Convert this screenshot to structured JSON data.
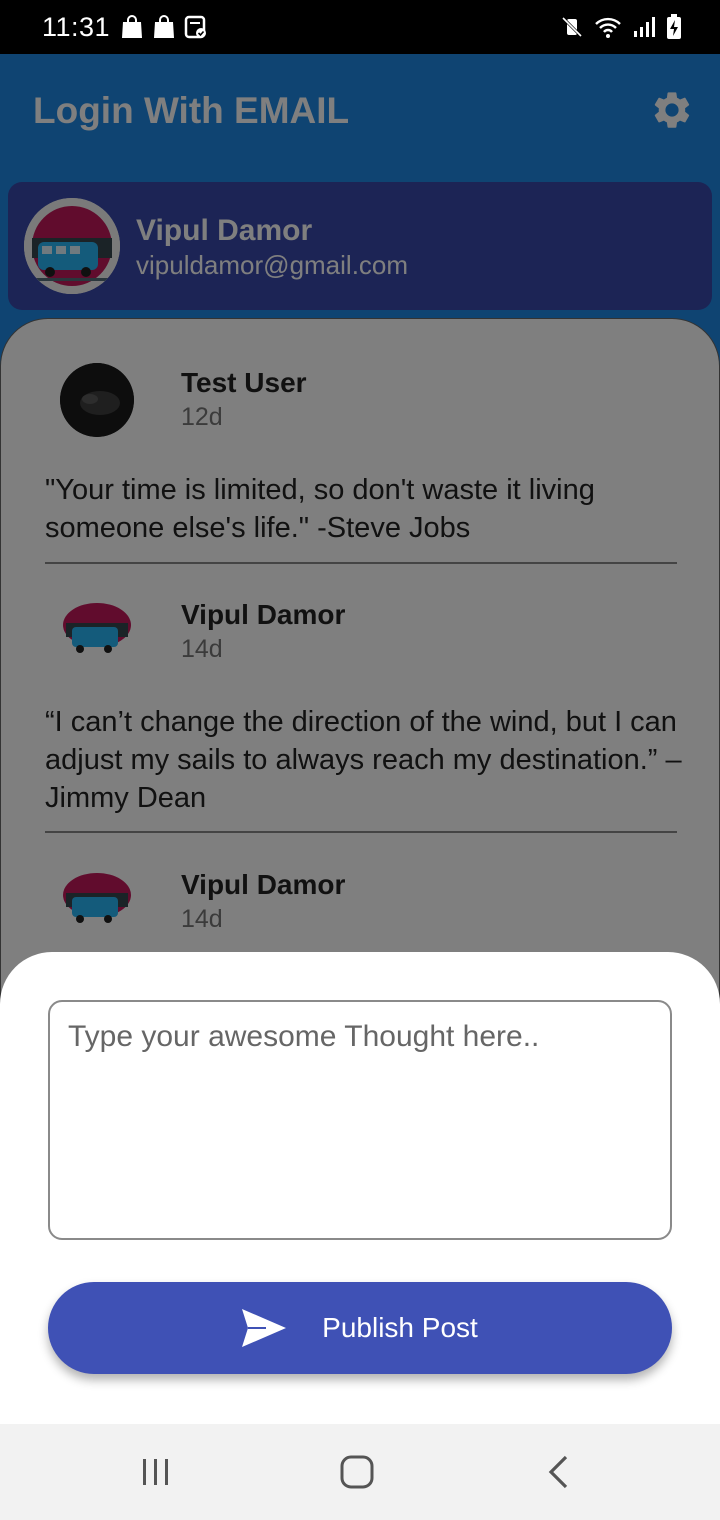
{
  "status_bar": {
    "time": "11:31"
  },
  "app_bar": {
    "title": "Login With EMAIL",
    "icons": [
      "settings-icon"
    ]
  },
  "profile": {
    "name": "Vipul Damor",
    "email": "vipuldamor@gmail.com"
  },
  "posts": [
    {
      "name": "Test User",
      "time": "12d",
      "text": "\"Your time is limited, so don't waste it living someone else's life.\" -Steve Jobs"
    },
    {
      "name": "Vipul Damor",
      "time": "14d",
      "text": "“I can’t change the direction of the wind, but I can adjust my sails to always reach my destination.” – Jimmy Dean"
    },
    {
      "name": "Vipul Damor",
      "time": "14d",
      "text": ""
    }
  ],
  "compose": {
    "placeholder": "Type your awesome Thought here..",
    "value": "",
    "publish_label": "Publish Post"
  },
  "colors": {
    "primary": "#1e88e5",
    "profile_card": "#3949ab",
    "button": "#3f51b5"
  }
}
